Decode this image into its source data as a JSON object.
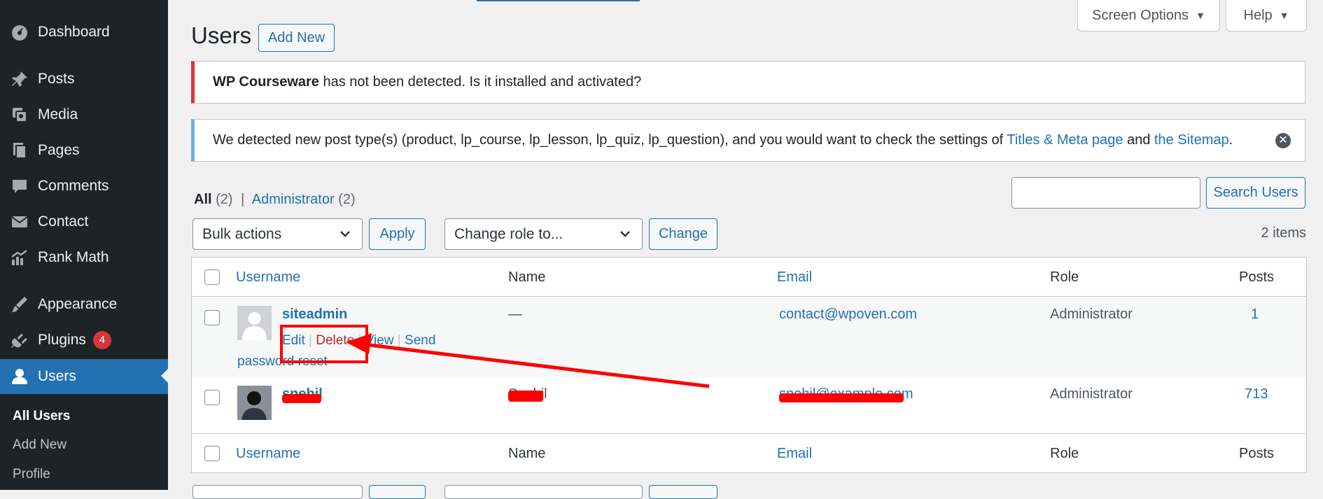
{
  "sidebar": {
    "items": [
      {
        "label": "Dashboard",
        "icon": "dashboard-icon"
      },
      {
        "label": "Posts",
        "icon": "pin-icon"
      },
      {
        "label": "Media",
        "icon": "media-icon"
      },
      {
        "label": "Pages",
        "icon": "pages-icon"
      },
      {
        "label": "Comments",
        "icon": "comment-icon"
      },
      {
        "label": "Contact",
        "icon": "mail-icon"
      },
      {
        "label": "Rank Math",
        "icon": "chart-icon"
      },
      {
        "label": "Appearance",
        "icon": "brush-icon"
      },
      {
        "label": "Plugins",
        "icon": "plug-icon",
        "badge": "4"
      },
      {
        "label": "Users",
        "icon": "user-icon"
      }
    ],
    "submenu": [
      "All Users",
      "Add New",
      "Profile"
    ]
  },
  "topbar": {
    "screen_options": "Screen Options",
    "help": "Help"
  },
  "header": {
    "title": "Users",
    "add_new": "Add New"
  },
  "notices": {
    "error": {
      "bold": "WP Courseware",
      "text": " has not been detected. Is it installed and activated?"
    },
    "info": {
      "text1": "We detected new post type(s) (product, lp_course, lp_lesson, lp_quiz, lp_question), and you would want to check the settings of ",
      "link1": "Titles & Meta page",
      "text2": " and ",
      "link2": "the Sitemap",
      "text3": "."
    }
  },
  "filters": {
    "all": "All",
    "all_count": "(2)",
    "separator": "|",
    "admin": "Administrator",
    "admin_count": "(2)",
    "search_button": "Search Users",
    "bulk_actions": "Bulk actions",
    "apply": "Apply",
    "change_role": "Change role to...",
    "change": "Change",
    "items_count": "2 items"
  },
  "table": {
    "headers": {
      "username": "Username",
      "name": "Name",
      "email": "Email",
      "role": "Role",
      "posts": "Posts"
    },
    "rows": [
      {
        "username": "siteadmin",
        "name": "—",
        "email": "contact@wpoven.com",
        "role": "Administrator",
        "posts": "1",
        "actions": {
          "edit": "Edit",
          "delete": "Delete",
          "view": "View",
          "send": "Send",
          "reset": "password reset",
          "sep": "|"
        }
      },
      {
        "username": "snehil",
        "name": "Snehil",
        "email": "snehil@example.com",
        "role": "Administrator",
        "posts": "713"
      }
    ]
  },
  "annotation": {
    "color": "#ff0000"
  }
}
